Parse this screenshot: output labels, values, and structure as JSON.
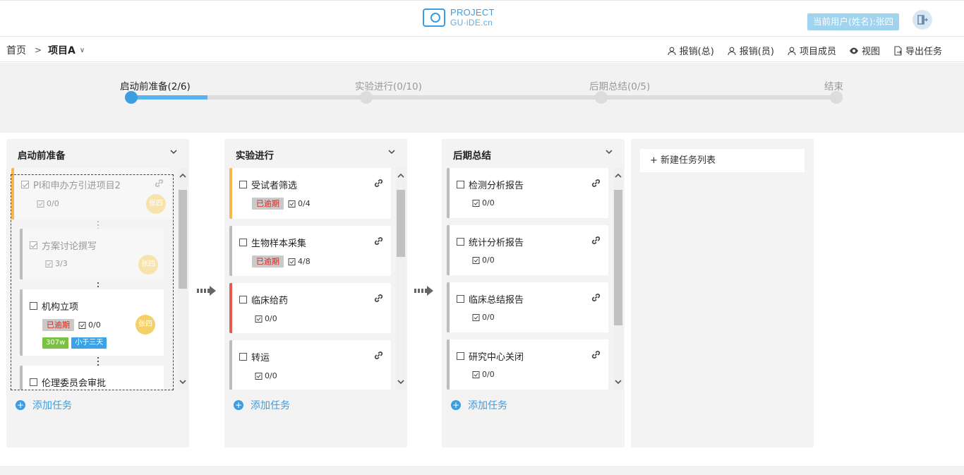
{
  "header": {
    "logo_line1": "PROJECT",
    "logo_line2": "GU·iDE.cn",
    "current_user": "当前用户(姓名):张四"
  },
  "breadcrumb": {
    "home": "首页",
    "separator": ">",
    "project": "项目A"
  },
  "actions": [
    {
      "label": "报销(总)",
      "icon": "users-icon"
    },
    {
      "label": "报销(员)",
      "icon": "users-icon"
    },
    {
      "label": "项目成员",
      "icon": "users-icon"
    },
    {
      "label": "视图",
      "icon": "eye-icon"
    },
    {
      "label": "导出任务",
      "icon": "export-icon"
    }
  ],
  "stages": [
    {
      "label": "启动前准备(2/6)",
      "active": true
    },
    {
      "label": "实验进行(0/10)",
      "active": false
    },
    {
      "label": "后期总结(0/5)",
      "active": false
    },
    {
      "label": "结束",
      "active": false
    }
  ],
  "stage_progress": 0.108,
  "columns": [
    {
      "title": "启动前准备",
      "add_label": "添加任务",
      "cards": [
        {
          "title": "PI和申办方引进项目2",
          "done": true,
          "progress": "0/0",
          "avatar": "张四"
        },
        {
          "title": "方案讨论撰写",
          "done": true,
          "progress": "3/3",
          "avatar": "张四"
        },
        {
          "title": "机构立项",
          "done": false,
          "overdue": "已逾期",
          "progress": "0/0",
          "avatar": "张四",
          "tags": [
            "307w",
            "小于三天"
          ]
        },
        {
          "title": "伦理委员会审批",
          "done": false
        }
      ]
    },
    {
      "title": "实验进行",
      "add_label": "添加任务",
      "cards": [
        {
          "title": "受试者筛选",
          "overdue": "已逾期",
          "progress": "0/4"
        },
        {
          "title": "生物样本采集",
          "overdue": "已逾期",
          "progress": "4/8"
        },
        {
          "title": "临床给药",
          "progress": "0/0"
        },
        {
          "title": "转运",
          "progress": "0/0"
        }
      ]
    },
    {
      "title": "后期总结",
      "add_label": "添加任务",
      "cards": [
        {
          "title": "检测分析报告",
          "progress": "0/0"
        },
        {
          "title": "统计分析报告",
          "progress": "0/0"
        },
        {
          "title": "临床总结报告",
          "progress": "0/0"
        },
        {
          "title": "研究中心关闭",
          "progress": "0/0"
        }
      ]
    }
  ],
  "new_list_label": "+ 新建任务列表",
  "colors": {
    "accent": "#3a9ee0",
    "progress_fill": "#5ab3ef",
    "overdue_text": "#d9261c",
    "card_orange": "#f5b94b",
    "card_red": "#e85a4f"
  }
}
